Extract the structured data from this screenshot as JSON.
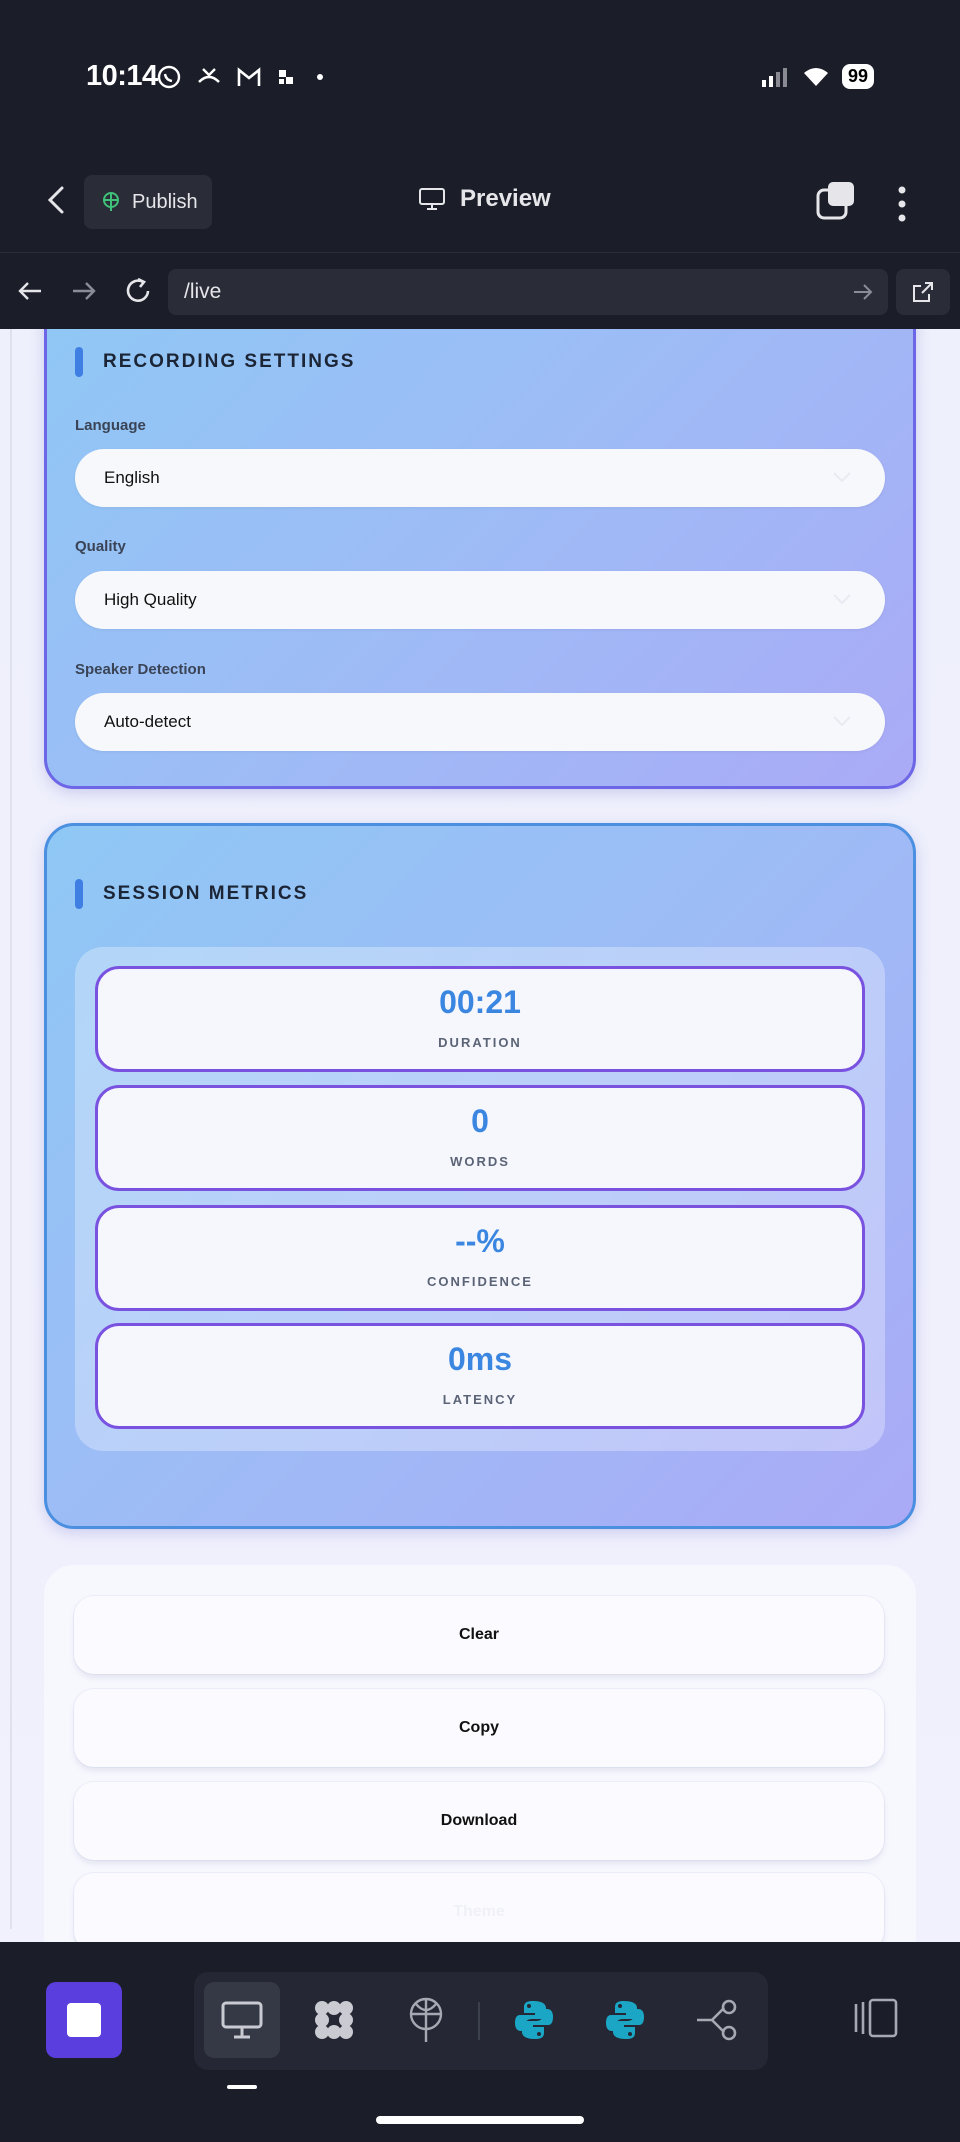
{
  "status_bar": {
    "time": "10:14",
    "battery": "99"
  },
  "app_bar": {
    "publish_label": "Publish",
    "title": "Preview"
  },
  "url_bar": {
    "url": "/live"
  },
  "recording_settings": {
    "title": "RECORDING SETTINGS",
    "fields": [
      {
        "label": "Language",
        "value": "English"
      },
      {
        "label": "Quality",
        "value": "High Quality"
      },
      {
        "label": "Speaker Detection",
        "value": "Auto-detect"
      }
    ]
  },
  "session_metrics": {
    "title": "SESSION METRICS",
    "items": [
      {
        "value": "00:21",
        "label": "DURATION"
      },
      {
        "value": "0",
        "label": "WORDS"
      },
      {
        "value": "--%",
        "label": "CONFIDENCE"
      },
      {
        "value": "0ms",
        "label": "LATENCY"
      }
    ]
  },
  "actions": {
    "clear": "Clear",
    "copy": "Copy",
    "download": "Download",
    "theme": "Theme"
  },
  "colors": {
    "accent_purple": "#5b3ede",
    "metric_value_blue": "#3a86e0",
    "metric_border": "#7a52e0",
    "dark_chrome": "#1b1e29"
  },
  "icons": [
    "whatsapp-icon",
    "missed-call-icon",
    "gmail-icon",
    "app-icon",
    "signal-icon",
    "wifi-icon",
    "back-icon",
    "publish-globe-icon",
    "monitor-icon",
    "windows-icon",
    "more-icon",
    "arrow-left-icon",
    "arrow-right-icon",
    "reload-icon",
    "go-icon",
    "external-link-icon",
    "chevron-down-icon",
    "desktop-icon",
    "dots-grid-icon",
    "antenna-icon",
    "python-icon",
    "share-nodes-icon",
    "sidebar-toggle-icon"
  ]
}
